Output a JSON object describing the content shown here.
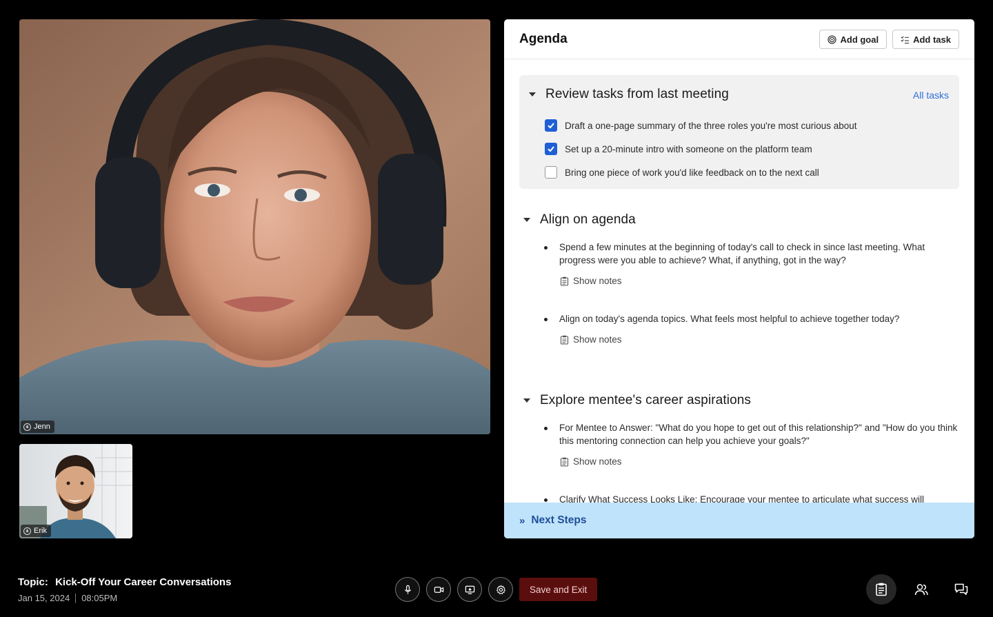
{
  "videos": {
    "main": {
      "name": "Jenn"
    },
    "thumb": {
      "name": "Erik"
    }
  },
  "agenda": {
    "title": "Agenda",
    "add_goal_label": "Add goal",
    "add_task_label": "Add task",
    "review": {
      "title": "Review tasks from last meeting",
      "all_tasks_label": "All tasks",
      "tasks": [
        {
          "label": "Draft a one-page summary of the three roles you're most curious about",
          "checked": true
        },
        {
          "label": "Set up a 20-minute intro with someone on the platform team",
          "checked": true
        },
        {
          "label": "Bring one piece of work you'd like feedback on to the next call",
          "checked": false
        }
      ]
    },
    "sections": [
      {
        "title": "Align on agenda",
        "items": [
          {
            "text": "Spend a few minutes at the beginning of today's call to check in since last meeting. What progress were you able to achieve? What, if anything, got in the way?",
            "notes_label": "Show notes"
          },
          {
            "text": "Align on today's agenda topics. What feels most helpful to achieve together today?",
            "notes_label": "Show notes"
          }
        ]
      },
      {
        "title": "Explore mentee's career aspirations",
        "items": [
          {
            "text": "For Mentee to Answer: \"What do you hope to get out of this relationship?\" and \"How do you think this mentoring connection can help you achieve your goals?\"",
            "notes_label": "Show notes"
          },
          {
            "text": "Clarify What Success Looks Like: Encourage your mentee to articulate what success will"
          }
        ]
      }
    ],
    "next_steps_label": "Next Steps"
  },
  "footer": {
    "topic_key": "Topic:",
    "topic_value": "Kick-Off Your Career Conversations",
    "date": "Jan 15, 2024",
    "time": "08:05PM",
    "save_exit_label": "Save and Exit"
  },
  "colors": {
    "accent_blue": "#1f5fd6",
    "link_blue": "#2f6fdc",
    "next_steps_bg": "#bfe3fa",
    "save_exit_bg": "#5b0e0e"
  }
}
